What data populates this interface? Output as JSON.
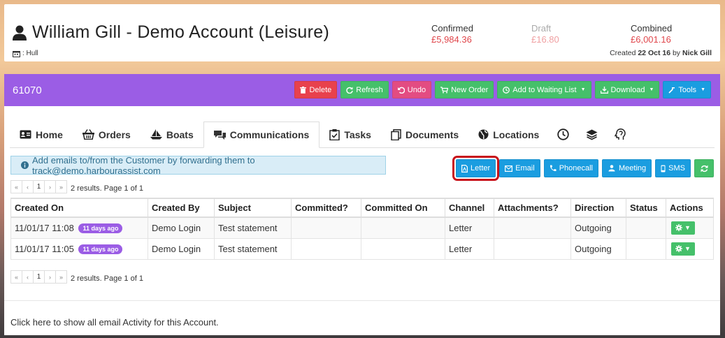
{
  "header": {
    "account_title": "William Gill - Demo Account (Leisure)",
    "location": ": Hull",
    "metrics": [
      {
        "label": "Confirmed",
        "value": "£5,984.36"
      },
      {
        "label": "Draft",
        "value": "£16.80"
      },
      {
        "label": "Combined",
        "value": "£6,001.16"
      }
    ],
    "created_prefix": "Created",
    "created_date": "22 Oct 16",
    "created_by_prefix": "by",
    "created_by": "Nick Gill"
  },
  "panel": {
    "account_id": "61070",
    "toolbar": {
      "delete": "Delete",
      "refresh": "Refresh",
      "undo": "Undo",
      "new_order": "New Order",
      "add_waiting": "Add to Waiting List",
      "download": "Download",
      "tools": "Tools"
    }
  },
  "tabs": [
    {
      "label": "Home"
    },
    {
      "label": "Orders"
    },
    {
      "label": "Boats"
    },
    {
      "label": "Communications"
    },
    {
      "label": "Tasks"
    },
    {
      "label": "Documents"
    },
    {
      "label": "Locations"
    }
  ],
  "info_alert": "Add emails to/from the Customer by forwarding them to track@demo.harbourassist.com",
  "actions": {
    "letter": "Letter",
    "email": "Email",
    "phonecall": "Phonecall",
    "meeting": "Meeting",
    "sms": "SMS"
  },
  "pager": {
    "first": "«",
    "prev": "‹",
    "page": "1",
    "next": "›",
    "last": "»",
    "summary": "2 results. Page 1 of 1"
  },
  "table": {
    "columns": [
      "Created On",
      "Created By",
      "Subject",
      "Committed?",
      "Committed On",
      "Channel",
      "Attachments?",
      "Direction",
      "Status",
      "Actions"
    ],
    "rows": [
      {
        "created_on": "11/01/17 11:08",
        "age": "11 days ago",
        "created_by": "Demo Login",
        "subject": "Test statement",
        "committed": "",
        "committed_on": "",
        "channel": "Letter",
        "attachments": "",
        "direction": "Outgoing",
        "status": ""
      },
      {
        "created_on": "11/01/17 11:05",
        "age": "11 days ago",
        "created_by": "Demo Login",
        "subject": "Test statement",
        "committed": "",
        "committed_on": "",
        "channel": "Letter",
        "attachments": "",
        "direction": "Outgoing",
        "status": ""
      }
    ]
  },
  "footer_link": "Click here to show all email Activity for this Account.",
  "colors": {
    "purple": "#9b5de5",
    "red": "#e8414d",
    "green": "#45c06a",
    "pink": "#e34c82",
    "blue": "#1a9de0",
    "money_red": "#e0474c"
  },
  "icons": [
    "user-icon",
    "calendar-icon",
    "trash-icon",
    "refresh-icon",
    "undo-icon",
    "cart-icon",
    "clock-icon",
    "download-icon",
    "tools-icon",
    "id-card-icon",
    "basket-icon",
    "boat-icon",
    "comments-icon",
    "tasks-icon",
    "documents-icon",
    "globe-icon",
    "history-icon",
    "layers-icon",
    "brain-icon",
    "info-icon",
    "pdf-icon",
    "envelope-icon",
    "phone-icon",
    "meeting-icon",
    "mobile-icon",
    "gear-icon"
  ]
}
